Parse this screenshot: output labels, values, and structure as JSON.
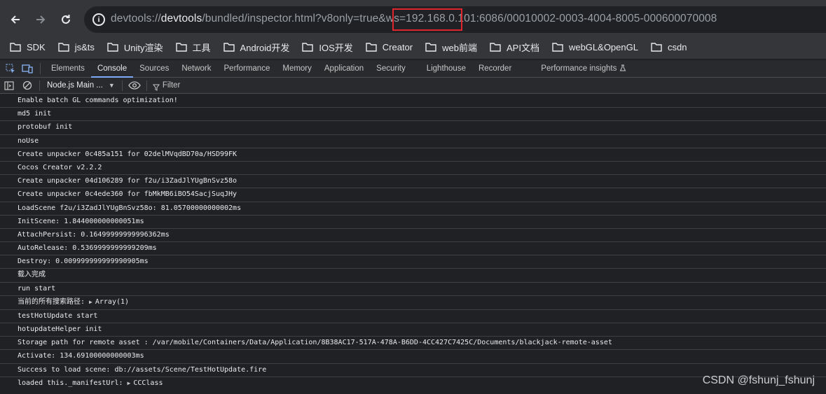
{
  "browser": {
    "url_prefix": "devtools://",
    "url_host": "devtools",
    "url_path_1": "/bundled/inspector.html?v8only=true&ws=",
    "url_ip": "192.168.0.101:",
    "url_rest": "6086/00010002-0003-4004-8005-000600070008"
  },
  "bookmarks": [
    "SDK",
    "js&ts",
    "Unity渲染",
    "工具",
    "Android开发",
    "IOS开发",
    "Creator",
    "web前端",
    "API文档",
    "webGL&OpenGL",
    "csdn"
  ],
  "devtools": {
    "tabs": [
      "Elements",
      "Console",
      "Sources",
      "Network",
      "Performance",
      "Memory",
      "Application",
      "Security",
      "Lighthouse",
      "Recorder",
      "Performance insights"
    ],
    "active_tab": "Console",
    "context_label": "Node.js Main ...",
    "filter_placeholder": "Filter"
  },
  "console": {
    "lines": [
      "Enable batch GL commands optimization!",
      "md5 init",
      "protobuf init",
      "noUse",
      "Create unpacker 0c485a151 for 02delMVqdBD70a/HSD99FK",
      "Cocos Creator v2.2.2",
      "Create unpacker 04d106289 for f2u/i3ZadJlYUgBnSvz58o",
      "Create unpacker 0c4ede360 for fbMkMB6iBO54SacjSuqJHy",
      "LoadScene f2u/i3ZadJlYUgBnSvz58o: 81.05700000000002ms",
      "InitScene: 1.844000000000051ms",
      "AttachPersist: 0.16499999999996362ms",
      "AutoRelease: 0.5369999999999209ms",
      "Destroy: 0.009999999999990905ms",
      "载入完成",
      "run start",
      "当前的所有搜索路径:",
      "testHotUpdate start",
      "hotupdateHelper init",
      "Storage path for remote asset : /var/mobile/Containers/Data/Application/8B38AC17-517A-478A-B6DD-4CC427C7425C/Documents/blackjack-remote-asset",
      "Activate: 134.69100000000003ms",
      "Success to load scene: db://assets/Scene/TestHotUpdate.fire",
      "loaded this._manifestUrl:"
    ],
    "line15_object": "Array(1)",
    "line21_object": "CCClass"
  },
  "watermark": "CSDN @fshunj_fshunj",
  "colors": {
    "highlight_box": "#e0252d",
    "active_tab_underline": "#7cacf8"
  }
}
